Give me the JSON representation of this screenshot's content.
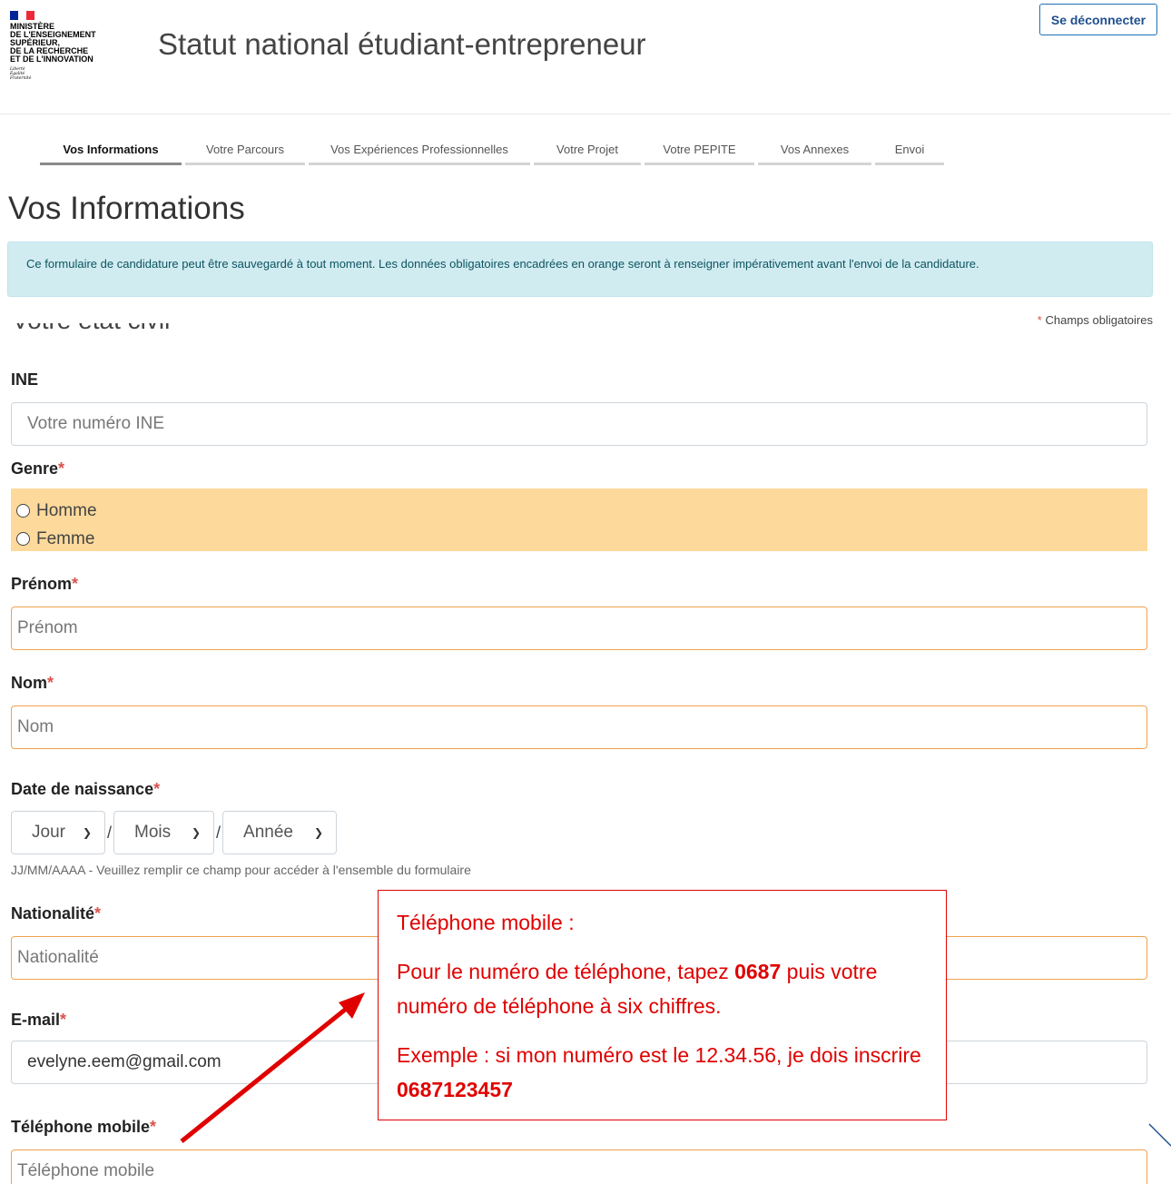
{
  "header": {
    "logo": {
      "lines": [
        "MINISTÈRE",
        "DE L'ENSEIGNEMENT",
        "SUPÉRIEUR,",
        "DE LA RECHERCHE",
        "ET DE L'INNOVATION"
      ],
      "motto": [
        "Liberté",
        "Égalité",
        "Fraternité"
      ],
      "flag_colors": [
        "#002395",
        "#ffffff",
        "#ed2939"
      ]
    },
    "title": "Statut national étudiant-entrepreneur",
    "logout_label": "Se déconnecter"
  },
  "tabs": [
    {
      "label": "Vos Informations",
      "active": true
    },
    {
      "label": "Votre Parcours",
      "active": false
    },
    {
      "label": "Vos Expériences Professionnelles",
      "active": false
    },
    {
      "label": "Votre Projet",
      "active": false
    },
    {
      "label": "Votre PEPITE",
      "active": false
    },
    {
      "label": "Vos Annexes",
      "active": false
    },
    {
      "label": "Envoi",
      "active": false
    }
  ],
  "page_title": "Vos Informations",
  "info_banner": "Ce formulaire de candidature peut être sauvegardé à tout moment. Les données obligatoires encadrées en orange seront à renseigner impérativement avant l'envoi de la candidature.",
  "required_note": {
    "star": "*",
    "text": "Champs obligatoires"
  },
  "section_title": "Votre état civil",
  "form": {
    "ine": {
      "label": "INE",
      "placeholder": "Votre numéro INE"
    },
    "genre": {
      "label": "Genre",
      "star": "*",
      "options": [
        "Homme",
        "Femme"
      ]
    },
    "prenom": {
      "label": "Prénom",
      "star": "*",
      "placeholder": "Prénom"
    },
    "nom": {
      "label": "Nom",
      "star": "*",
      "placeholder": "Nom"
    },
    "date_naissance": {
      "label": "Date de naissance",
      "star": "*",
      "day": "Jour",
      "month": "Mois",
      "year": "Année",
      "separator": "/",
      "help": "JJ/MM/AAAA - Veuillez remplir ce champ pour accéder à l'ensemble du formulaire"
    },
    "nationalite": {
      "label": "Nationalité",
      "star": "*",
      "placeholder": "Nationalité"
    },
    "email": {
      "label": "E-mail",
      "star": "*",
      "value": "evelyne.eem@gmail.com"
    },
    "telephone": {
      "label": "Téléphone mobile",
      "star": "*",
      "placeholder": "Téléphone mobile"
    }
  },
  "callout": {
    "title": "Téléphone mobile :",
    "line1_before": "Pour le numéro de téléphone, tapez ",
    "line1_bold": "0687",
    "line1_after": " puis votre numéro de téléphone à six chiffres.",
    "line2_before": "Exemple : si mon numéro est le 12.34.56, je dois inscrire ",
    "line2_bold": "0687123457",
    "color": "#e00000"
  }
}
